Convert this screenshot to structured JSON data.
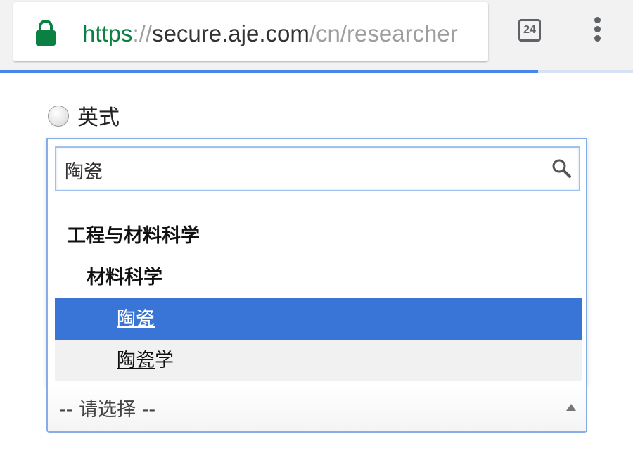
{
  "browser": {
    "url_scheme": "https",
    "url_separator": "://",
    "url_host": "secure.aje.com",
    "url_path": "/cn/researcher",
    "tab_count": "24",
    "colors": {
      "secure": "#0b8043",
      "progress": "#4a86e8",
      "selection": "#3875d7"
    }
  },
  "page": {
    "radio_label": "英式"
  },
  "dropdown": {
    "search_value": "陶瓷",
    "options": [
      {
        "label": "工程与材料科学",
        "type": "group"
      },
      {
        "label": "材料科学",
        "type": "group"
      },
      {
        "match": "陶瓷",
        "rest": "",
        "type": "option",
        "state": "selected"
      },
      {
        "match": "陶瓷",
        "rest": "学",
        "type": "option",
        "state": "normal"
      }
    ]
  },
  "select": {
    "value": "-- 请选择 --"
  },
  "icons": {
    "lock": "lock-icon",
    "tabs": "tab-switcher-icon",
    "menu": "overflow-menu-icon",
    "search": "search-icon",
    "arrow": "triangle-up-icon"
  }
}
